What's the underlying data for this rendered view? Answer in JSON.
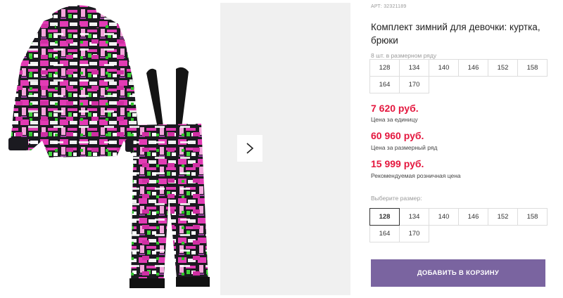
{
  "product": {
    "article": "АРТ: 32321189",
    "title": "Комплект зимний для девочки: куртка, брюки"
  },
  "size_row": {
    "note": "8 шт. в размерном ряду",
    "sizes": [
      "128",
      "134",
      "140",
      "146",
      "152",
      "158",
      "164",
      "170"
    ]
  },
  "prices": {
    "unit_price": "7 620 руб.",
    "unit_label": "Цена за единицу",
    "row_price": "60 960 руб.",
    "row_label": "Цена за размерный ряд",
    "retail_price": "15 999 руб.",
    "retail_label": "Рекомендуемая розничная цена"
  },
  "size_select": {
    "label": "Выберите размер:",
    "selected": "128",
    "options": [
      "128",
      "134",
      "140",
      "146",
      "152",
      "158",
      "164",
      "170"
    ]
  },
  "actions": {
    "add_to_cart": "ДОБАВИТЬ В КОРЗИНУ"
  },
  "colors": {
    "price": "#e4173e",
    "button": "#7a64a0",
    "print_pink": "#e23bb4",
    "print_green": "#3fd63a"
  },
  "icons": {
    "gallery_next": "chevron-right-icon"
  }
}
